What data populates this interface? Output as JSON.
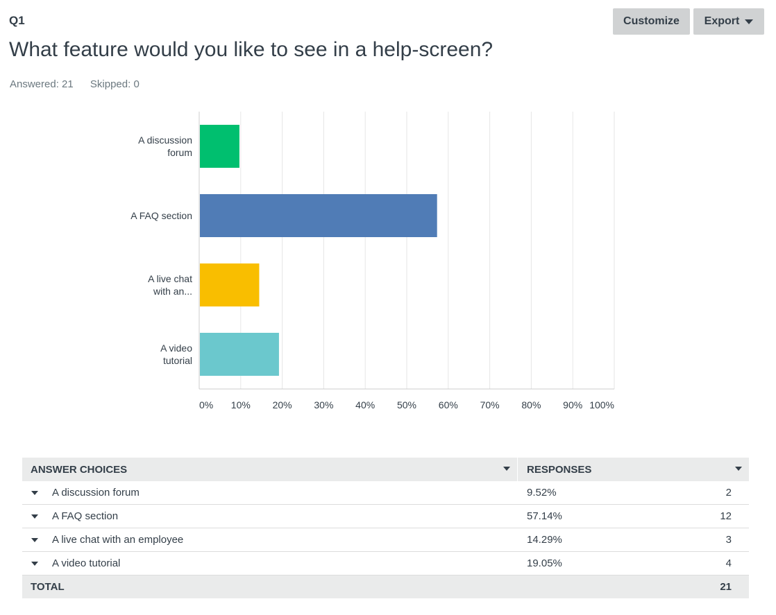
{
  "question": {
    "number": "Q1",
    "title": "What feature would you like to see in a help-screen?",
    "answered": "Answered: 21",
    "skipped": "Skipped: 0"
  },
  "toolbar": {
    "customize_label": "Customize",
    "export_label": "Export"
  },
  "chart_data": {
    "type": "bar",
    "orientation": "horizontal",
    "categories": [
      "A discussion forum",
      "A FAQ section",
      "A live chat with an employee",
      "A video tutorial"
    ],
    "category_display_lines": [
      [
        "A discussion",
        "forum"
      ],
      [
        "A FAQ section"
      ],
      [
        "A live chat",
        "with an..."
      ],
      [
        "A video",
        "tutorial"
      ]
    ],
    "values": [
      9.52,
      57.14,
      14.29,
      19.05
    ],
    "colors": [
      "#00bf6f",
      "#507cb6",
      "#f9be00",
      "#6bc8cd"
    ],
    "xlim": [
      0,
      100
    ],
    "ticks": [
      "0%",
      "10%",
      "20%",
      "30%",
      "40%",
      "50%",
      "60%",
      "70%",
      "80%",
      "90%",
      "100%"
    ],
    "grid": true
  },
  "table": {
    "headers": [
      "ANSWER CHOICES",
      "RESPONSES"
    ],
    "rows": [
      {
        "choice": "A discussion forum",
        "percent": "9.52%",
        "count": "2"
      },
      {
        "choice": "A FAQ section",
        "percent": "57.14%",
        "count": "12"
      },
      {
        "choice": "A live chat with an employee",
        "percent": "14.29%",
        "count": "3"
      },
      {
        "choice": "A video tutorial",
        "percent": "19.05%",
        "count": "4"
      }
    ],
    "total_label": "TOTAL",
    "total_count": "21"
  }
}
